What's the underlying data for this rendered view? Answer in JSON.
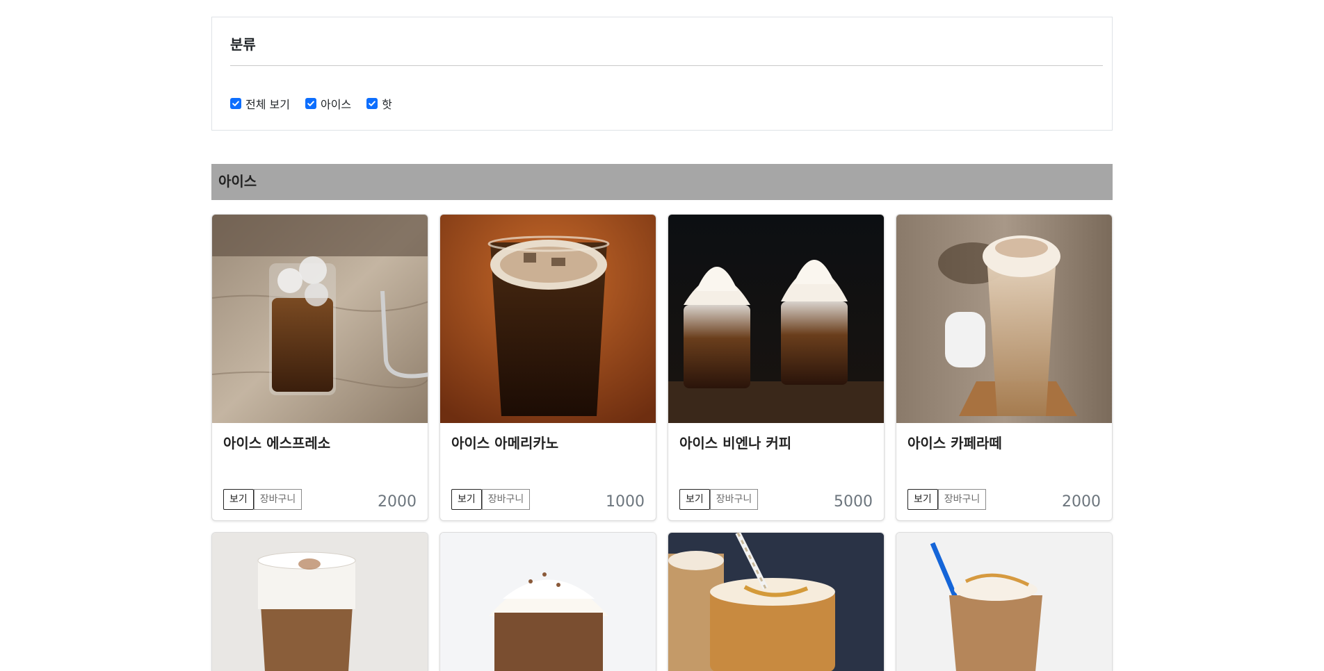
{
  "filter": {
    "title": "분류",
    "options": [
      {
        "label": "전체 보기",
        "checked": true
      },
      {
        "label": "아이스",
        "checked": true
      },
      {
        "label": "핫",
        "checked": true
      }
    ],
    "accent_color": "#0d6efd"
  },
  "section": {
    "title": "아이스"
  },
  "products": [
    {
      "name": "아이스 에스프레소",
      "price": "2000",
      "view_label": "보기",
      "cart_label": "장바구니",
      "image": "iced-espresso-photo"
    },
    {
      "name": "아이스 아메리카노",
      "price": "1000",
      "view_label": "보기",
      "cart_label": "장바구니",
      "image": "iced-americano-photo"
    },
    {
      "name": "아이스 비엔나 커피",
      "price": "5000",
      "view_label": "보기",
      "cart_label": "장바구니",
      "image": "iced-vienna-coffee-photo"
    },
    {
      "name": "아이스 카페라떼",
      "price": "2000",
      "view_label": "보기",
      "cart_label": "장바구니",
      "image": "iced-cafe-latte-photo"
    }
  ],
  "more_products_images": [
    "iced-cappuccino-photo",
    "iced-mocha-photo",
    "iced-caramel-macchiato-photo",
    "iced-caramel-latte-photo"
  ]
}
